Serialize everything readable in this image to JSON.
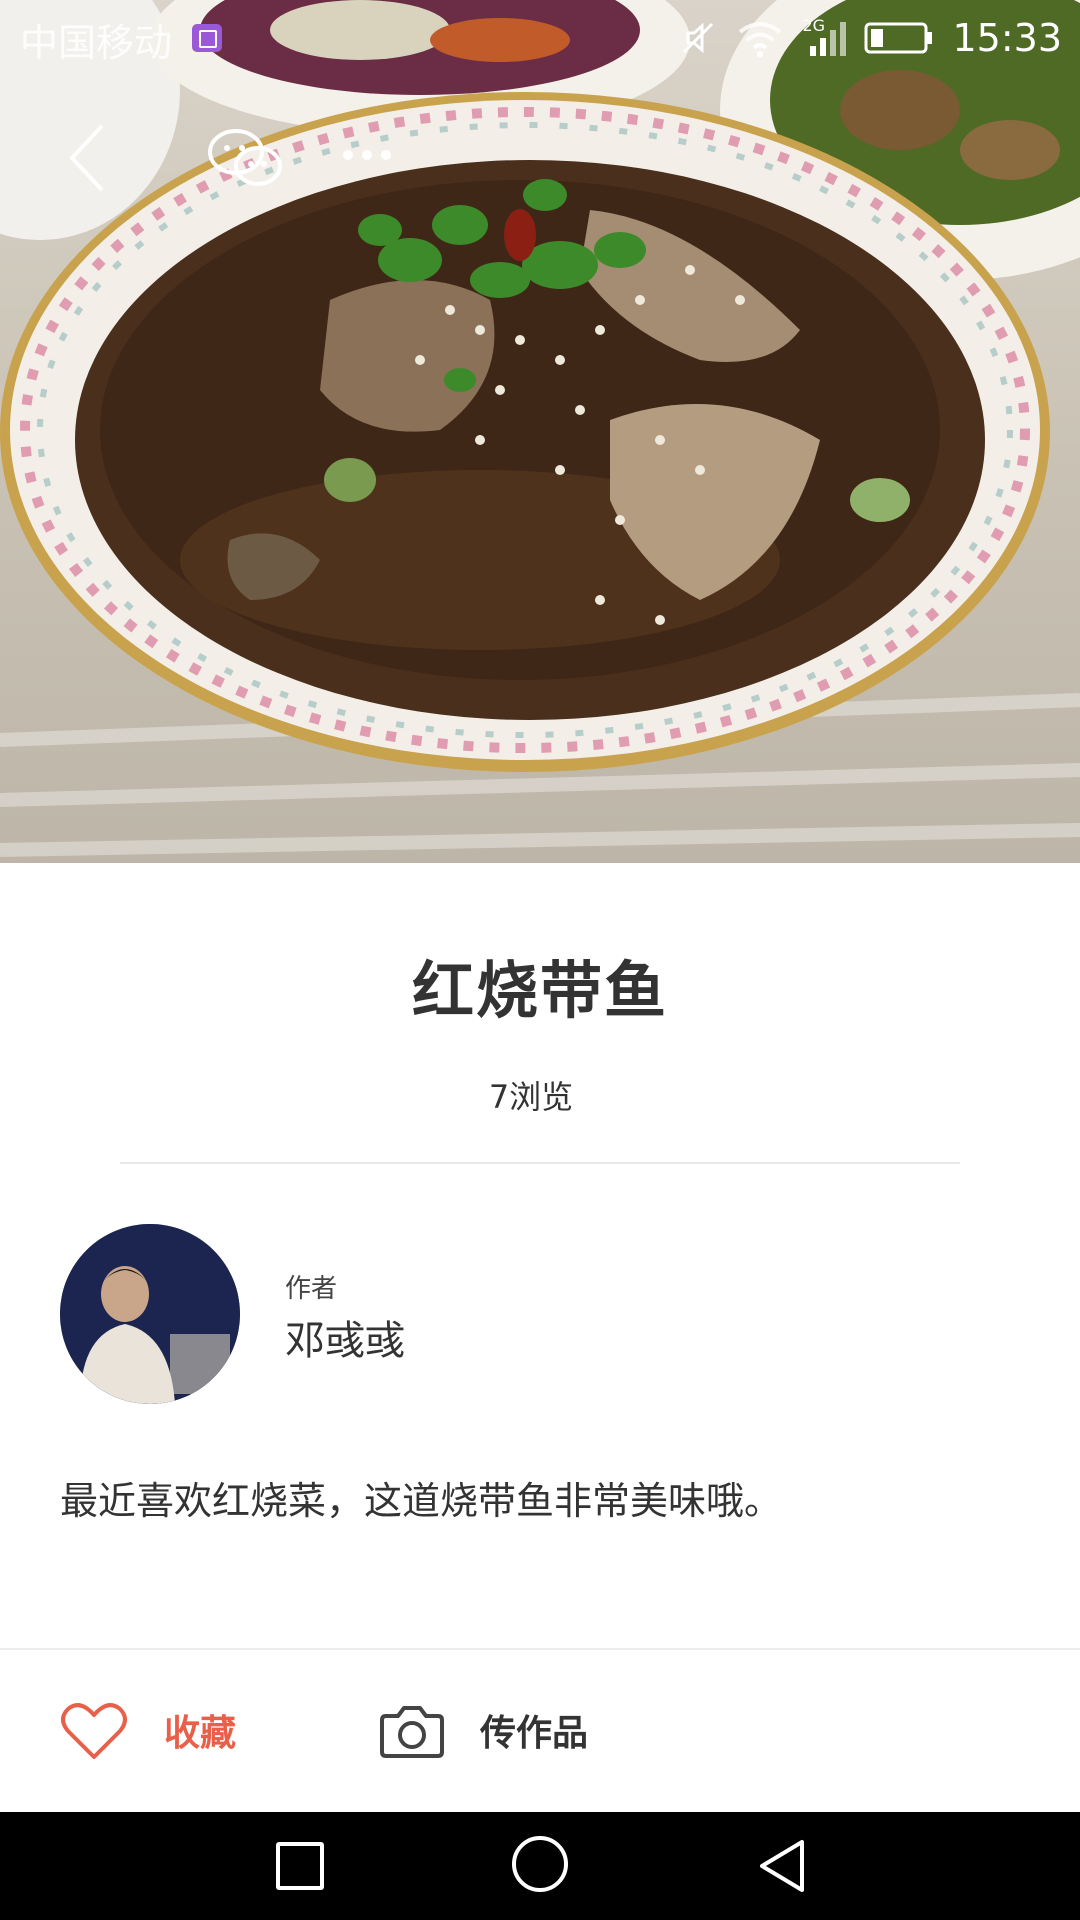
{
  "status_bar": {
    "carrier": "中国移动",
    "network": "2G",
    "time": "15:33"
  },
  "recipe": {
    "title": "红烧带鱼",
    "views": "7浏览",
    "author_label": "作者",
    "author_name": "邓彧彧",
    "description": "最近喜欢红烧菜，这道烧带鱼非常美味哦。"
  },
  "actions": {
    "favorite_label": "收藏",
    "upload_label": "传作品"
  },
  "colors": {
    "accent": "#e8604a",
    "text": "#333333",
    "navbar": "#000000"
  },
  "icons": [
    "chevron-left-icon",
    "wechat-icon",
    "more-icon",
    "heart-icon",
    "camera-icon",
    "recent-apps-icon",
    "home-icon",
    "back-icon"
  ]
}
